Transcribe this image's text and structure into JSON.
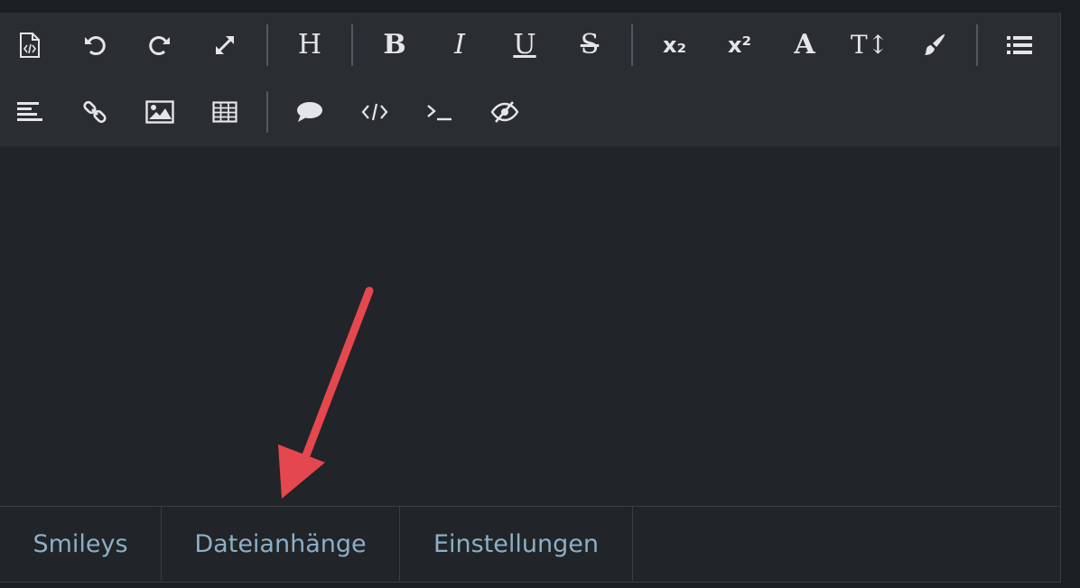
{
  "toolbar": {
    "row1": [
      {
        "name": "source-code-icon",
        "title": "Quellcode"
      },
      {
        "name": "undo-icon",
        "title": "Rückgängig"
      },
      {
        "name": "redo-icon",
        "title": "Wiederholen"
      },
      {
        "name": "fullscreen-icon",
        "title": "Vollbild"
      },
      {
        "name": "heading-icon",
        "glyph": "H"
      },
      {
        "name": "bold-icon",
        "glyph": "B"
      },
      {
        "name": "italic-icon",
        "glyph": "I"
      },
      {
        "name": "underline-icon",
        "glyph": "U"
      },
      {
        "name": "strikethrough-icon",
        "glyph": "S"
      },
      {
        "name": "subscript-icon",
        "glyph": "x₂"
      },
      {
        "name": "superscript-icon",
        "glyph": "x²"
      },
      {
        "name": "font-icon",
        "glyph": "A"
      },
      {
        "name": "font-size-icon",
        "glyph": "T↕"
      },
      {
        "name": "paintbrush-icon"
      },
      {
        "name": "list-icon"
      }
    ],
    "row2": [
      {
        "name": "align-left-icon"
      },
      {
        "name": "link-icon"
      },
      {
        "name": "image-icon"
      },
      {
        "name": "table-icon"
      },
      {
        "name": "quote-icon"
      },
      {
        "name": "code-icon"
      },
      {
        "name": "terminal-icon"
      },
      {
        "name": "spoiler-icon"
      }
    ]
  },
  "tabs": {
    "smileys": "Smileys",
    "attachments": "Dateianhänge",
    "settings": "Einstellungen"
  },
  "annotation": {
    "arrow_color": "#e5474f"
  }
}
